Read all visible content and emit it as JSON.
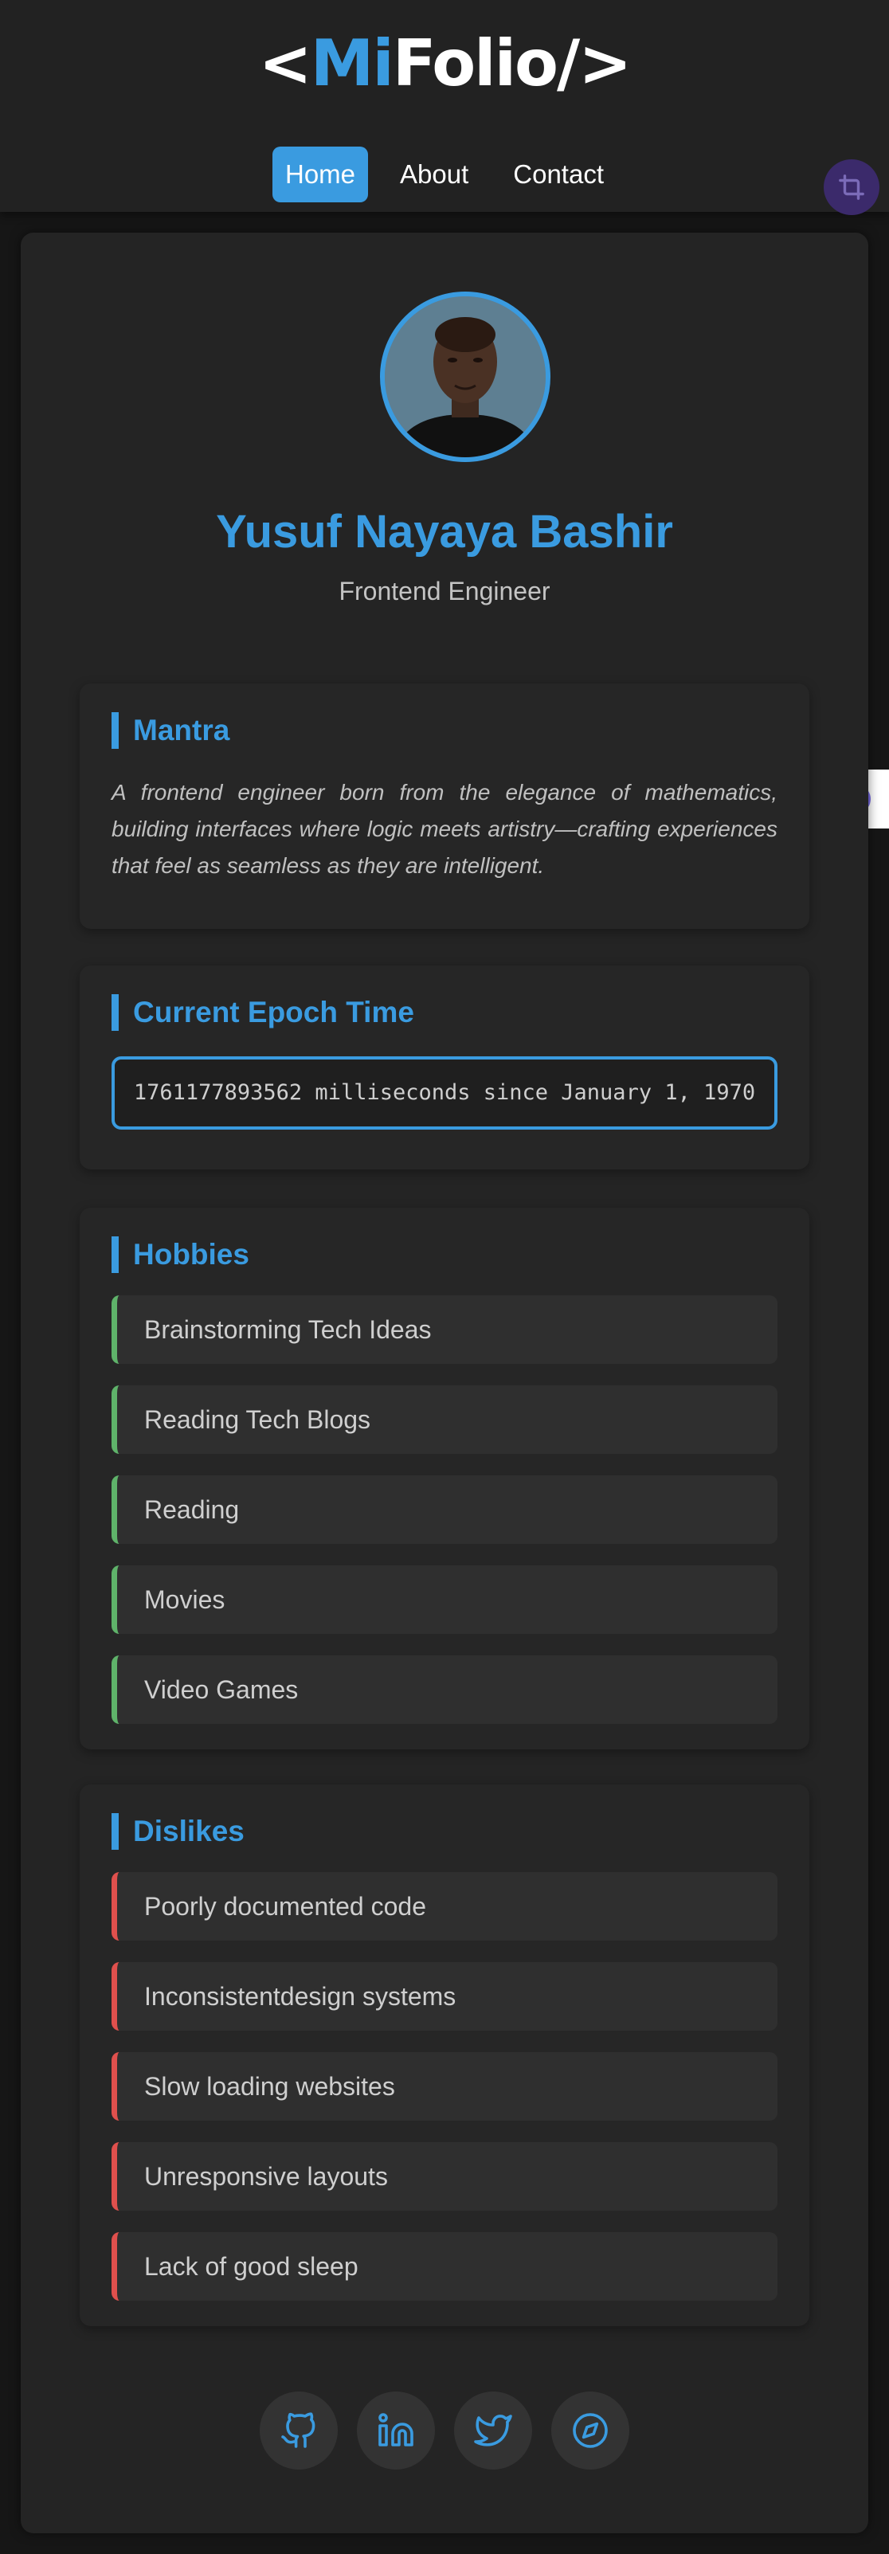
{
  "header": {
    "logo_open": "<",
    "logo_accent": "Mi",
    "logo_rest": "Folio/",
    "logo_close": ">",
    "nav": [
      {
        "label": "Home",
        "active": true
      },
      {
        "label": "About",
        "active": false
      },
      {
        "label": "Contact",
        "active": false
      }
    ]
  },
  "profile": {
    "name": "Yusuf Nayaya Bashir",
    "role": "Frontend Engineer"
  },
  "mantra": {
    "title": "Mantra",
    "text": "A frontend engineer born from the elegance of mathematics, building interfaces where logic meets artistry—crafting experiences that feel as seamless as they are intelligent."
  },
  "epoch": {
    "title": "Current Epoch Time",
    "text": "1761177893562 milliseconds since January 1, 1970"
  },
  "hobbies": {
    "title": "Hobbies",
    "items": [
      "Brainstorming Tech Ideas",
      "Reading Tech Blogs",
      "Reading",
      "Movies",
      "Video Games"
    ]
  },
  "dislikes": {
    "title": "Dislikes",
    "items": [
      "Poorly documented code",
      "Inconsistentdesign systems",
      "Slow loading websites",
      "Unresponsive layouts",
      "Lack of good sleep"
    ]
  },
  "social": [
    "github-icon",
    "linkedin-icon",
    "twitter-icon",
    "compass-icon"
  ],
  "colors": {
    "accent": "#3a9be0",
    "hobby_border": "#5fb36a",
    "dislike_border": "#e0504d",
    "background": "#161616",
    "card": "#242424"
  }
}
